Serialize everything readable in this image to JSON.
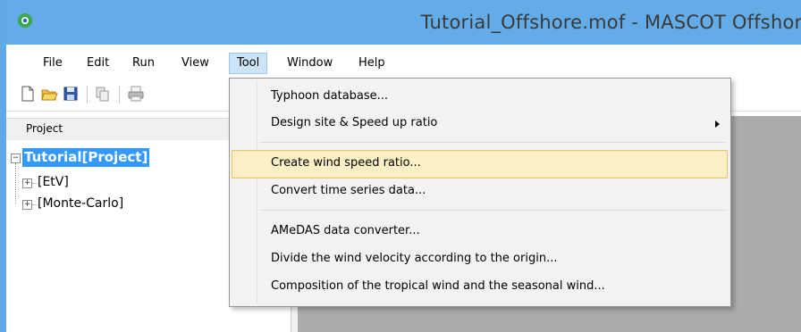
{
  "window": {
    "title": "Tutorial_Offshore.mof - MASCOT Offshore"
  },
  "menubar": {
    "items": [
      "File",
      "Edit",
      "Run",
      "View",
      "Tool",
      "Window",
      "Help"
    ],
    "active": "Tool"
  },
  "toolbar": {
    "buttons": [
      "new-file-icon",
      "open-folder-icon",
      "save-icon",
      "copy-icon",
      "print-icon"
    ]
  },
  "project": {
    "header": "Project",
    "root": "Tutorial[Project]",
    "children": [
      "[EtV]",
      "[Monte-Carlo]"
    ]
  },
  "tool_menu": {
    "items": [
      "Typhoon database...",
      "Design site & Speed up ratio",
      "Create wind speed ratio...",
      "Convert time series data...",
      "AMeDAS data converter...",
      "Divide the wind velocity according to the origin...",
      "Composition of the tropical wind and the seasonal wind..."
    ],
    "highlighted": "Create wind speed ratio..."
  },
  "colors": {
    "titlebar": "#64ace8",
    "highlight": "#fcefc6",
    "selection": "#3399ff",
    "workspace": "#ababab"
  }
}
